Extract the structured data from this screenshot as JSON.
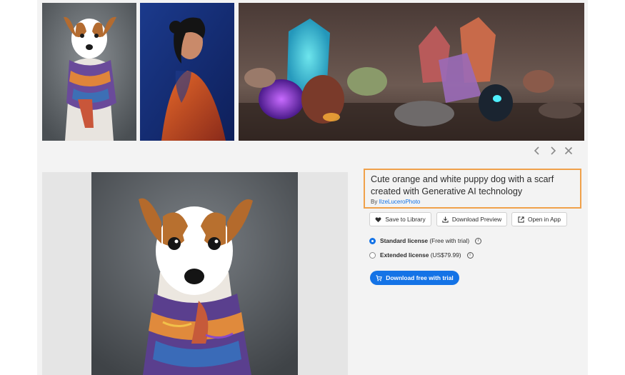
{
  "gallery": {
    "thumbnails": [
      {
        "name": "puppy-thumbnail",
        "subject": "dog with scarf"
      },
      {
        "name": "woman-thumbnail",
        "subject": "woman portrait"
      },
      {
        "name": "crystals-thumbnail",
        "subject": "glowing crystals"
      }
    ]
  },
  "nav": {
    "prev_icon": "chevron-left-icon",
    "next_icon": "chevron-right-icon",
    "close_icon": "close-icon"
  },
  "asset": {
    "title": "Cute orange and white puppy dog with a scarf created with Generative AI technology",
    "by_prefix": "By ",
    "author": "IlzeLuceroPhoto"
  },
  "actions": {
    "save_label": "Save to Library",
    "download_preview_label": "Download Preview",
    "open_in_app_label": "Open in App"
  },
  "licenses": {
    "standard": {
      "name": "Standard license",
      "detail": "(Free with trial)",
      "selected": true
    },
    "extended": {
      "name": "Extended license",
      "detail": "(US$79.99)",
      "selected": false
    }
  },
  "cta": {
    "label": "Download free with trial"
  },
  "colors": {
    "accent": "#1473e6",
    "highlight_border": "#f0a14a",
    "panel_bg": "#f3f3f3"
  }
}
